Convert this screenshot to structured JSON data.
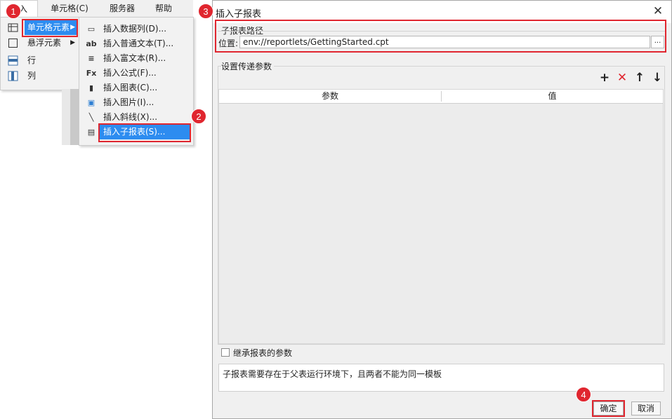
{
  "menubar": {
    "insert": "插入",
    "cell": "单元格(C)",
    "server": "服务器",
    "help": "帮助"
  },
  "menu1": {
    "items": [
      {
        "label": "单元格元素"
      },
      {
        "label": "悬浮元素"
      },
      {
        "label": "行"
      },
      {
        "label": "列"
      }
    ]
  },
  "menu2": {
    "items": [
      {
        "icon": "▭",
        "label": "插入数据列(D)..."
      },
      {
        "icon": "ab",
        "label": "插入普通文本(T)..."
      },
      {
        "icon": "≡",
        "label": "插入富文本(R)..."
      },
      {
        "icon": "Fx",
        "label": "插入公式(F)..."
      },
      {
        "icon": "▮",
        "label": "插入图表(C)..."
      },
      {
        "icon": "▣",
        "label": "插入图片(I)..."
      },
      {
        "icon": "╲",
        "label": "插入斜线(X)..."
      },
      {
        "icon": "▤",
        "label": "插入子报表(S)..."
      }
    ]
  },
  "badges": {
    "b1": "1",
    "b2": "2",
    "b3": "3",
    "b4": "4"
  },
  "dialog": {
    "title": "插入子报表",
    "close": "✕",
    "path_group": "子报表路径",
    "location_label": "位置:",
    "location_value": "env://reportlets/GettingStarted.cpt",
    "browse": "...",
    "param_group": "设置传递参数",
    "tools": {
      "add": "+",
      "delete": "✕",
      "up": "↑",
      "down": "↓"
    },
    "columns": [
      "参数",
      "值"
    ],
    "inherit_label": "继承报表的参数",
    "note": "子报表需要存在于父表运行环境下，且两者不能为同一模板",
    "ok": "确定",
    "cancel": "取消"
  },
  "colors": {
    "accent": "#2d8cf0",
    "highlight": "#e0262f",
    "delete": "#e0262f"
  }
}
